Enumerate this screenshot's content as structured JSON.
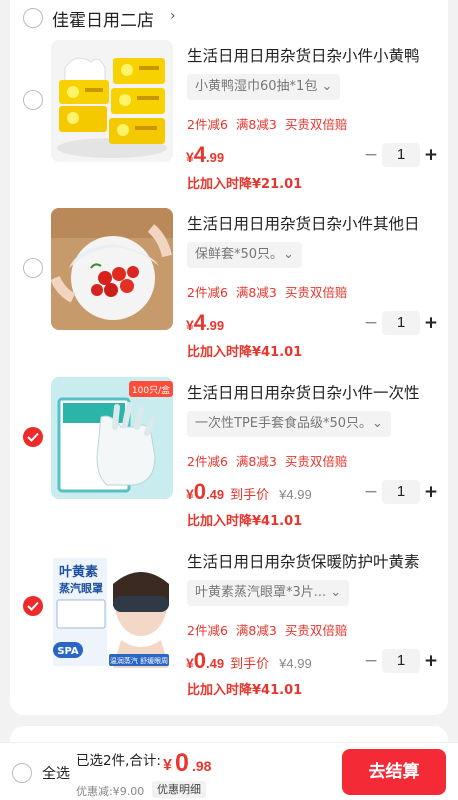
{
  "store": {
    "name": "佳霍日用二店",
    "chevron": "›"
  },
  "items": [
    {
      "title": "生活日用日用杂货日杂小件小黄鸭",
      "sku": "小黄鸭湿巾60抽*1包 ⌄",
      "promos": [
        "2件减6",
        "满8减3",
        "买贵双倍赔"
      ],
      "price_cur": "¥",
      "price_int": "4",
      "price_dec": ".99",
      "price_tag": "",
      "orig_price": "",
      "drop": "比加入时降¥21.01",
      "qty": "1",
      "checked": false,
      "image": "wet-wipes-product-photo"
    },
    {
      "title": "生活日用日用杂货日杂小件其他日",
      "sku": "保鲜套*50只。⌄",
      "promos": [
        "2件减6",
        "满8减3",
        "买贵双倍赔"
      ],
      "price_cur": "¥",
      "price_int": "4",
      "price_dec": ".99",
      "price_tag": "",
      "orig_price": "",
      "drop": "比加入时降¥41.01",
      "qty": "1",
      "checked": false,
      "image": "food-cover-product-photo"
    },
    {
      "title": "生活日用日用杂货日杂小件一次性",
      "sku": "一次性TPE手套食品级*50只。⌄",
      "promos": [
        "2件减6",
        "满8减3",
        "买贵双倍赔"
      ],
      "price_cur": "¥",
      "price_int": "0",
      "price_dec": ".49",
      "price_tag": "到手价",
      "orig_price": "¥4.99",
      "drop": "比加入时降¥41.01",
      "qty": "1",
      "checked": true,
      "image": "gloves-product-photo",
      "badge": "100只/盒"
    },
    {
      "title": "生活日用日用杂货保暖防护叶黄素",
      "sku": "叶黄素蒸汽眼罩*3片... ⌄",
      "promos": [
        "2件减6",
        "满8减3",
        "买贵双倍赔"
      ],
      "price_cur": "¥",
      "price_int": "0",
      "price_dec": ".49",
      "price_tag": "到手价",
      "orig_price": "¥4.99",
      "drop": "比加入时降¥41.01",
      "qty": "1",
      "checked": true,
      "image": "eye-mask-product-photo",
      "img_text": [
        "叶黄素",
        "蒸汽眼罩",
        "SPA",
        "温润蒸汽 舒缓眼周"
      ]
    }
  ],
  "stepper": {
    "minus": "−",
    "plus": "+"
  },
  "footer": {
    "select_all": "全选",
    "summary": "已选2件,合计:",
    "total_cur": "¥",
    "total_int": "0",
    "total_dec": ".98",
    "discount": "优惠减:¥9.00",
    "detail": "优惠明细",
    "checkout": "去结算"
  },
  "colors": {
    "accent": "#e8352d",
    "checkout": "#f42a36",
    "bg": "#f2f2f2"
  }
}
